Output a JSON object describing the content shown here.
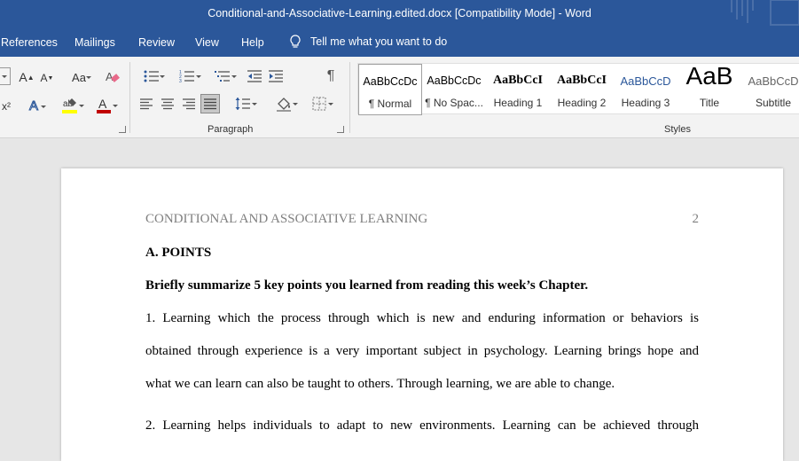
{
  "window": {
    "title": "Conditional-and-Associative-Learning.edited.docx [Compatibility Mode]  -  Word"
  },
  "menu": {
    "tabs": [
      "References",
      "Mailings",
      "Review",
      "View",
      "Help"
    ],
    "tell_me": "Tell me what you want to do"
  },
  "ribbon": {
    "paragraph_label": "Paragraph",
    "styles_label": "Styles",
    "font_buttons": {
      "grow": "A",
      "shrink": "A",
      "change_case": "Aa",
      "superscript": "x²",
      "text_effects": "A",
      "font_color": "A"
    },
    "pilcrow": "¶",
    "styles": [
      {
        "preview": "AaBbCcDc",
        "name": "¶ Normal"
      },
      {
        "preview": "AaBbCcDc",
        "name": "¶ No Spac..."
      },
      {
        "preview": "AaBbCcI",
        "name": "Heading 1"
      },
      {
        "preview": "AaBbCcI",
        "name": "Heading 2"
      },
      {
        "preview": "AaBbCcD",
        "name": "Heading 3"
      },
      {
        "preview": "AaB",
        "name": "Title"
      },
      {
        "preview": "AaBbCcD",
        "name": "Subtitle"
      }
    ],
    "colors": {
      "highlight": "#ffff00",
      "font_color": "#c00000"
    }
  },
  "document": {
    "header_title": "CONDITIONAL AND ASSOCIATIVE LEARNING",
    "page_number": "2",
    "heading": "A. POINTS",
    "prompt": "Briefly summarize 5 key points you learned from reading this week’s Chapter.",
    "p1_lines": [
      "1. Learning which the process through which is new and enduring information or behaviors is",
      "obtained through experience is a very important subject in psychology. Learning brings hope and",
      "what we can learn can also be taught to others. Through learning, we are able to change."
    ],
    "p2_lines": [
      "2. Learning helps individuals to adapt to new environments. Learning can be achieved through"
    ]
  }
}
